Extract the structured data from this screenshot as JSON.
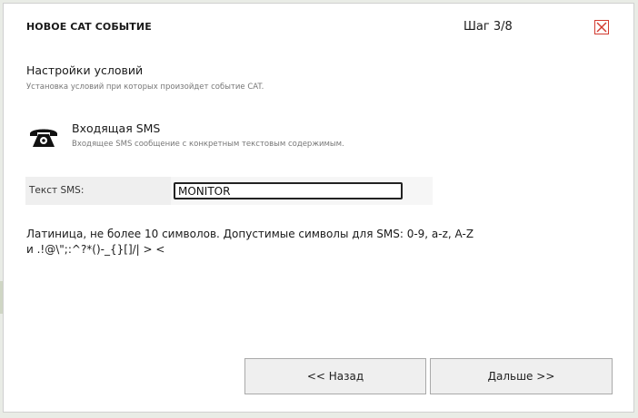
{
  "dialog": {
    "title": "НОВОЕ CAT СОБЫТИЕ",
    "step": "Шаг 3/8",
    "close_icon": "close-icon"
  },
  "section": {
    "title": "Настройки условий",
    "subtitle": "Установка условий при которых произойдет событие CAT."
  },
  "event": {
    "icon": "phone-icon",
    "title": "Входящая SMS",
    "subtitle": "Входящее SMS сообщение с конкретным текстовым содержимым."
  },
  "form": {
    "label": "Текст SMS:",
    "value": "MONITOR"
  },
  "hint": {
    "line1": "Латиница, не более 10 символов. Допустимые символы для SMS: 0-9, a-z, A-Z",
    "line2": "и .!@\\\";:^?*()-_{}[]/| > <"
  },
  "buttons": {
    "back": "<< Назад",
    "next": "Дальше >>"
  },
  "colors": {
    "close_red": "#d23a2f",
    "row_bg": "#efefef",
    "button_bg": "#efefef"
  }
}
